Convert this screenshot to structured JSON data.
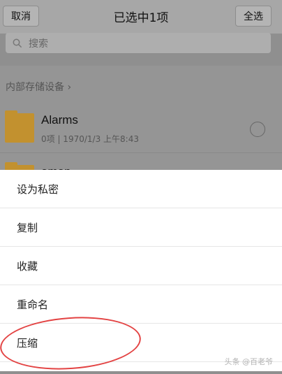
{
  "header": {
    "cancel": "取消",
    "title": "已选中1项",
    "select_all": "全选"
  },
  "search": {
    "placeholder": "搜索",
    "icon": "search-icon"
  },
  "breadcrumb": "内部存储设备 ›",
  "files": [
    {
      "name": "Alarms",
      "meta": "0项 | 1970/1/3 上午8:43",
      "icon": "folder-icon"
    },
    {
      "name": "amap",
      "icon": "folder-icon"
    }
  ],
  "actions": [
    "设为私密",
    "复制",
    "收藏",
    "重命名",
    "压缩"
  ],
  "watermark": "头条 @百老爷",
  "colors": {
    "highlight_ellipse": "#e34343"
  }
}
